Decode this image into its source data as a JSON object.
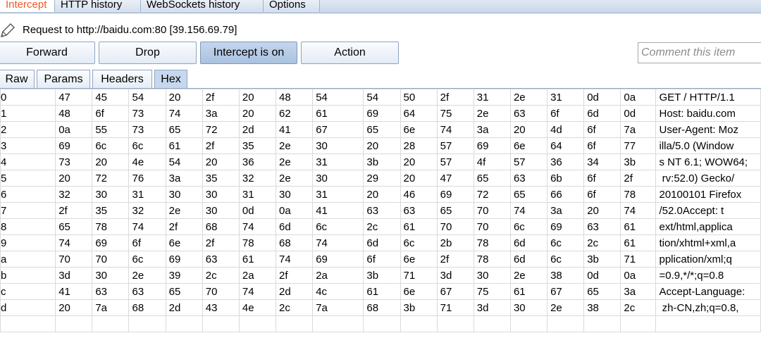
{
  "top_tabs": [
    "Intercept",
    "HTTP history",
    "WebSockets history",
    "Options"
  ],
  "request_line": "Request to http://baidu.com:80  [39.156.69.79]",
  "toolbar": {
    "forward": "Forward",
    "drop": "Drop",
    "intercept": "Intercept is on",
    "action": "Action",
    "comment_placeholder": "Comment this item"
  },
  "sub_tabs": [
    "Raw",
    "Params",
    "Headers",
    "Hex"
  ],
  "hex_rows": [
    {
      "idx": "0",
      "bytes": [
        "47",
        "45",
        "54",
        "20",
        "2f",
        "20",
        "48",
        "54",
        "54",
        "50",
        "2f",
        "31",
        "2e",
        "31",
        "0d",
        "0a"
      ],
      "ascii": "GET / HTTP/1.1"
    },
    {
      "idx": "1",
      "bytes": [
        "48",
        "6f",
        "73",
        "74",
        "3a",
        "20",
        "62",
        "61",
        "69",
        "64",
        "75",
        "2e",
        "63",
        "6f",
        "6d",
        "0d"
      ],
      "ascii": "Host: baidu.com"
    },
    {
      "idx": "2",
      "bytes": [
        "0a",
        "55",
        "73",
        "65",
        "72",
        "2d",
        "41",
        "67",
        "65",
        "6e",
        "74",
        "3a",
        "20",
        "4d",
        "6f",
        "7a"
      ],
      "ascii": "User-Agent: Moz"
    },
    {
      "idx": "3",
      "bytes": [
        "69",
        "6c",
        "6c",
        "61",
        "2f",
        "35",
        "2e",
        "30",
        "20",
        "28",
        "57",
        "69",
        "6e",
        "64",
        "6f",
        "77"
      ],
      "ascii": "illa/5.0 (Window"
    },
    {
      "idx": "4",
      "bytes": [
        "73",
        "20",
        "4e",
        "54",
        "20",
        "36",
        "2e",
        "31",
        "3b",
        "20",
        "57",
        "4f",
        "57",
        "36",
        "34",
        "3b"
      ],
      "ascii": "s NT 6.1; WOW64;"
    },
    {
      "idx": "5",
      "bytes": [
        "20",
        "72",
        "76",
        "3a",
        "35",
        "32",
        "2e",
        "30",
        "29",
        "20",
        "47",
        "65",
        "63",
        "6b",
        "6f",
        "2f"
      ],
      "ascii": " rv:52.0) Gecko/"
    },
    {
      "idx": "6",
      "bytes": [
        "32",
        "30",
        "31",
        "30",
        "30",
        "31",
        "30",
        "31",
        "20",
        "46",
        "69",
        "72",
        "65",
        "66",
        "6f",
        "78"
      ],
      "ascii": "20100101 Firefox"
    },
    {
      "idx": "7",
      "bytes": [
        "2f",
        "35",
        "32",
        "2e",
        "30",
        "0d",
        "0a",
        "41",
        "63",
        "63",
        "65",
        "70",
        "74",
        "3a",
        "20",
        "74"
      ],
      "ascii": "/52.0Accept: t"
    },
    {
      "idx": "8",
      "bytes": [
        "65",
        "78",
        "74",
        "2f",
        "68",
        "74",
        "6d",
        "6c",
        "2c",
        "61",
        "70",
        "70",
        "6c",
        "69",
        "63",
        "61"
      ],
      "ascii": "ext/html,applica"
    },
    {
      "idx": "9",
      "bytes": [
        "74",
        "69",
        "6f",
        "6e",
        "2f",
        "78",
        "68",
        "74",
        "6d",
        "6c",
        "2b",
        "78",
        "6d",
        "6c",
        "2c",
        "61"
      ],
      "ascii": "tion/xhtml+xml,a"
    },
    {
      "idx": "a",
      "bytes": [
        "70",
        "70",
        "6c",
        "69",
        "63",
        "61",
        "74",
        "69",
        "6f",
        "6e",
        "2f",
        "78",
        "6d",
        "6c",
        "3b",
        "71"
      ],
      "ascii": "pplication/xml;q"
    },
    {
      "idx": "b",
      "bytes": [
        "3d",
        "30",
        "2e",
        "39",
        "2c",
        "2a",
        "2f",
        "2a",
        "3b",
        "71",
        "3d",
        "30",
        "2e",
        "38",
        "0d",
        "0a"
      ],
      "ascii": "=0.9,*/*;q=0.8"
    },
    {
      "idx": "c",
      "bytes": [
        "41",
        "63",
        "63",
        "65",
        "70",
        "74",
        "2d",
        "4c",
        "61",
        "6e",
        "67",
        "75",
        "61",
        "67",
        "65",
        "3a"
      ],
      "ascii": "Accept-Language:"
    },
    {
      "idx": "d",
      "bytes": [
        "20",
        "7a",
        "68",
        "2d",
        "43",
        "4e",
        "2c",
        "7a",
        "68",
        "3b",
        "71",
        "3d",
        "30",
        "2e",
        "38",
        "2c"
      ],
      "ascii": " zh-CN,zh;q=0.8,"
    },
    {
      "idx": "",
      "bytes": [
        "",
        "",
        "",
        "",
        "",
        "",
        "",
        "",
        "",
        "",
        "",
        "",
        "",
        "",
        "",
        ""
      ],
      "ascii": ""
    }
  ],
  "colors": {
    "active_tab_text": "#ef5a2a",
    "button_on": "#b5cbe6",
    "grid": "#dadada"
  },
  "icons": {
    "edit": "pencil-icon"
  }
}
